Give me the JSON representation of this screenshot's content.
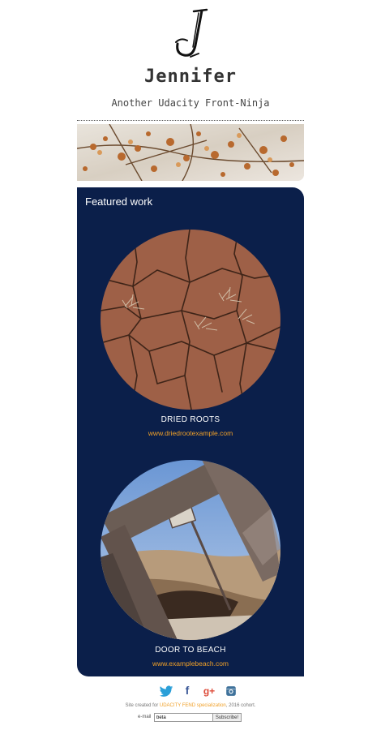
{
  "header": {
    "name": "Jennifer",
    "tagline": "Another Udacity Front-Ninja",
    "logo_icon": "handwritten-j-logo"
  },
  "featured": {
    "title": "Featured work",
    "background": "#0b1f4a",
    "works": [
      {
        "title": "DRIED ROOTS",
        "link": "www.driedrootexample.com"
      },
      {
        "title": "DOOR TO BEACH",
        "link": "www.examplebeach.com"
      }
    ]
  },
  "social": {
    "icons": [
      {
        "name": "twitter-icon",
        "glyph": "❀",
        "color": "#1da1f2"
      },
      {
        "name": "facebook-icon",
        "glyph": "f",
        "color": "#3b5998"
      },
      {
        "name": "google-plus-icon",
        "glyph": "g+",
        "color": "#dd4b39"
      },
      {
        "name": "instagram-icon",
        "glyph": "▣",
        "color": "#3f729b"
      }
    ]
  },
  "footer": {
    "credit_prefix": "Site created for ",
    "credit_link": "UDACITY FEND specialization",
    "credit_suffix": ", 2016 cohort.",
    "email_label": "e-mail",
    "email_value": "beta",
    "subscribe_label": "Subscribe!"
  },
  "colors": {
    "accent": "#f0a028",
    "panel": "#0b1f4a"
  }
}
